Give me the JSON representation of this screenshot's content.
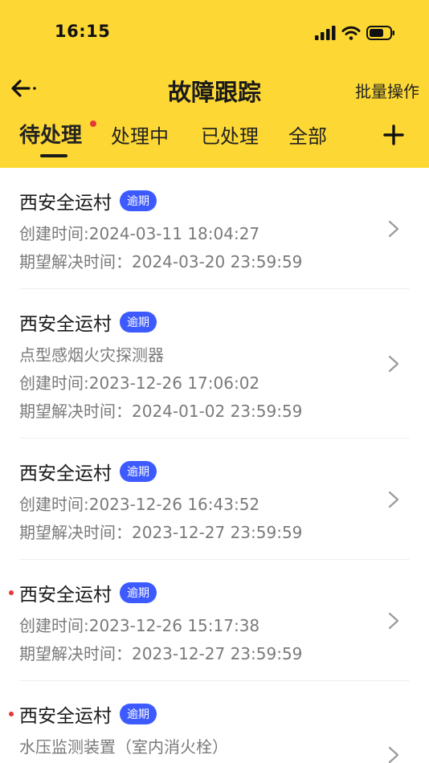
{
  "status_bar": {
    "time": "16:15"
  },
  "nav": {
    "title": "故障跟踪",
    "action": "批量操作"
  },
  "tabs": [
    {
      "label": "待处理",
      "active": true,
      "dot": true
    },
    {
      "label": "处理中",
      "active": false
    },
    {
      "label": "已处理",
      "active": false
    },
    {
      "label": "全部",
      "active": false
    }
  ],
  "colors": {
    "header": "#FDD835",
    "badge": "#3D5AFE",
    "dot": "#E53935"
  },
  "items": [
    {
      "title": "西安全运村",
      "badge": "逾期",
      "unread": false,
      "device": "",
      "created": "创建时间:2024-03-11 18:04:27",
      "expected": "期望解决时间：2024-03-20 23:59:59"
    },
    {
      "title": "西安全运村",
      "badge": "逾期",
      "unread": false,
      "device": "点型感烟火灾探测器",
      "created": "创建时间:2023-12-26 17:06:02",
      "expected": "期望解决时间：2024-01-02 23:59:59"
    },
    {
      "title": "西安全运村",
      "badge": "逾期",
      "unread": false,
      "device": "",
      "created": "创建时间:2023-12-26 16:43:52",
      "expected": "期望解决时间：2023-12-27 23:59:59"
    },
    {
      "title": "西安全运村",
      "badge": "逾期",
      "unread": true,
      "device": "",
      "created": "创建时间:2023-12-26 15:17:38",
      "expected": "期望解决时间：2023-12-27 23:59:59"
    },
    {
      "title": "西安全运村",
      "badge": "逾期",
      "unread": true,
      "device": "水压监测装置（室内消火栓）",
      "created": "",
      "expected": ""
    }
  ]
}
